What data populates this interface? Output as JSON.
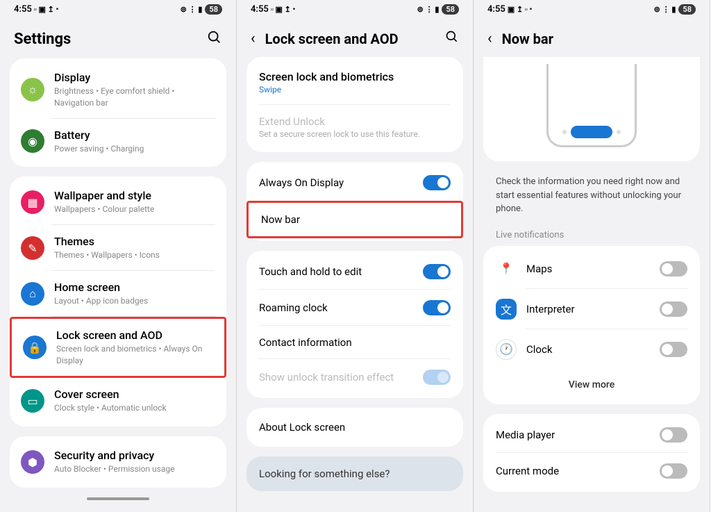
{
  "status": {
    "time": "4:55",
    "battery": "58"
  },
  "screen1": {
    "title": "Settings",
    "items": [
      {
        "title": "Display",
        "sub": "Brightness • Eye comfort shield • Navigation bar"
      },
      {
        "title": "Battery",
        "sub": "Power saving • Charging"
      },
      {
        "title": "Wallpaper and style",
        "sub": "Wallpapers • Colour palette"
      },
      {
        "title": "Themes",
        "sub": "Themes • Wallpapers • Icons"
      },
      {
        "title": "Home screen",
        "sub": "Layout • App icon badges"
      },
      {
        "title": "Lock screen and AOD",
        "sub": "Screen lock and biometrics • Always On Display"
      },
      {
        "title": "Cover screen",
        "sub": "Clock style • Automatic unlock"
      },
      {
        "title": "Security and privacy",
        "sub": "Auto Blocker • Permission usage"
      }
    ]
  },
  "screen2": {
    "title": "Lock screen and AOD",
    "screenLock": {
      "title": "Screen lock and biometrics",
      "value": "Swipe"
    },
    "extend": {
      "title": "Extend Unlock",
      "sub": "Set a secure screen lock to use this feature."
    },
    "rows": {
      "aod": "Always On Display",
      "nowbar": "Now bar",
      "touch": "Touch and hold to edit",
      "roaming": "Roaming clock",
      "contact": "Contact information",
      "unlock": "Show unlock transition effect"
    },
    "about": "About Lock screen",
    "footer": "Looking for something else?"
  },
  "screen3": {
    "title": "Now bar",
    "desc": "Check the information you need right now and start essential features without unlocking your phone.",
    "sectionHeader": "Live notifications",
    "apps": {
      "maps": "Maps",
      "interpreter": "Interpreter",
      "clock": "Clock"
    },
    "viewMore": "View more",
    "media": "Media player",
    "mode": "Current mode"
  }
}
